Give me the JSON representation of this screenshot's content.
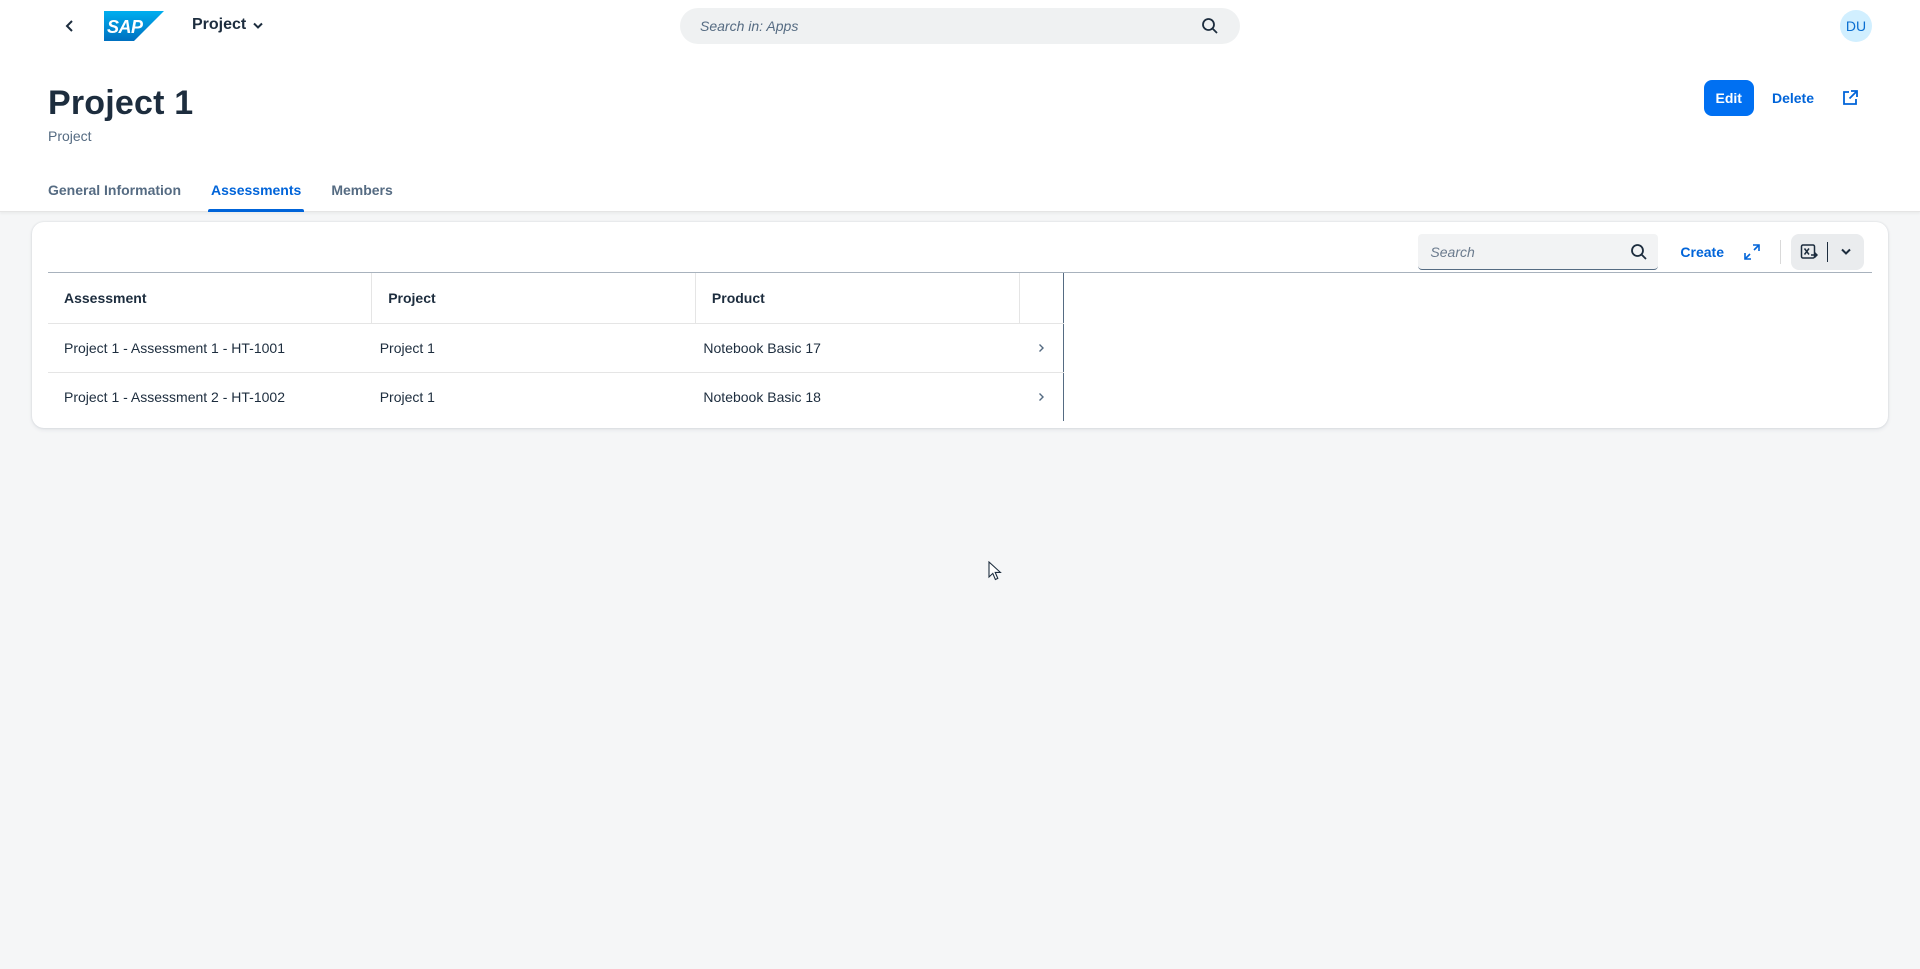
{
  "shell": {
    "app_title": "Project",
    "search_placeholder": "Search in: Apps",
    "avatar_initials": "DU",
    "brand_logo": "SAP"
  },
  "header": {
    "title": "Project 1",
    "subtitle": "Project",
    "actions": {
      "edit": "Edit",
      "delete": "Delete"
    },
    "tabs": [
      {
        "label": "General Information",
        "active": false
      },
      {
        "label": "Assessments",
        "active": true
      },
      {
        "label": "Members",
        "active": false
      }
    ]
  },
  "toolbar": {
    "search_placeholder": "Search",
    "create_label": "Create"
  },
  "table": {
    "columns": [
      "Assessment",
      "Project",
      "Product"
    ],
    "rows": [
      {
        "assessment": "Project 1 - Assessment 1 - HT-1001",
        "project": "Project 1",
        "product": "Notebook Basic 17"
      },
      {
        "assessment": "Project 1 - Assessment 2 - HT-1002",
        "project": "Project 1",
        "product": "Notebook Basic 18"
      }
    ]
  },
  "colors": {
    "accent": "#0070f2",
    "link": "#0064d9",
    "background": "#f5f6f7",
    "text": "#1d2d3e"
  }
}
